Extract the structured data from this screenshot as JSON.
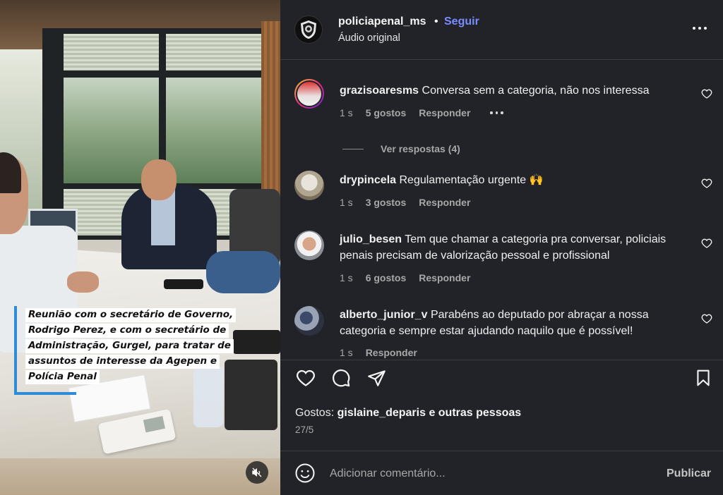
{
  "post": {
    "username": "policiapenal_ms",
    "separator": "•",
    "follow_label": "Seguir",
    "audio": "Áudio original",
    "caption_lines": [
      "Reunião com o secretário de Governo,",
      "Rodrigo Perez, e com o secretário de",
      "Administração, Gurgel, para tratar de",
      "assuntos de interesse da Agepen e",
      "Polícia Penal"
    ],
    "icons": {
      "more": "more-horizontal-icon",
      "mute": "speaker-muted-icon",
      "like": "heart-icon",
      "comment": "comment-bubble-icon",
      "share": "paper-plane-icon",
      "save": "bookmark-icon",
      "emoji": "smiley-icon"
    }
  },
  "comments": [
    {
      "username": "grazisoaresms",
      "text": "Conversa sem a categoria, não nos interessa",
      "time": "1 s",
      "likes": "5 gostos",
      "reply": "Responder",
      "view_replies": "Ver respostas (4)"
    },
    {
      "username": "drypincela",
      "text": "Regulamentação urgente 🙌",
      "time": "1 s",
      "likes": "3 gostos",
      "reply": "Responder"
    },
    {
      "username": "julio_besen",
      "text": "Tem que chamar a categoria pra conversar, policiais penais precisam de valorização pessoal e profissional",
      "time": "1 s",
      "likes": "6 gostos",
      "reply": "Responder"
    },
    {
      "username": "alberto_junior_v",
      "text": "Parabéns ao deputado por abraçar a nossa categoria e sempre estar ajudando naquilo que é possível!",
      "time": "1 s",
      "reply": "Responder"
    }
  ],
  "likes": {
    "prefix": "Gostos:",
    "user": "gislaine_deparis",
    "suffix": "e outras pessoas"
  },
  "date": "27/5",
  "comment_box": {
    "placeholder": "Adicionar comentário...",
    "publish_label": "Publicar"
  },
  "colors": {
    "panel_bg": "#212328",
    "follow_blue": "#7a8cff",
    "caption_accent": "#2e8bd8",
    "muted_text": "#a8a8a8"
  }
}
